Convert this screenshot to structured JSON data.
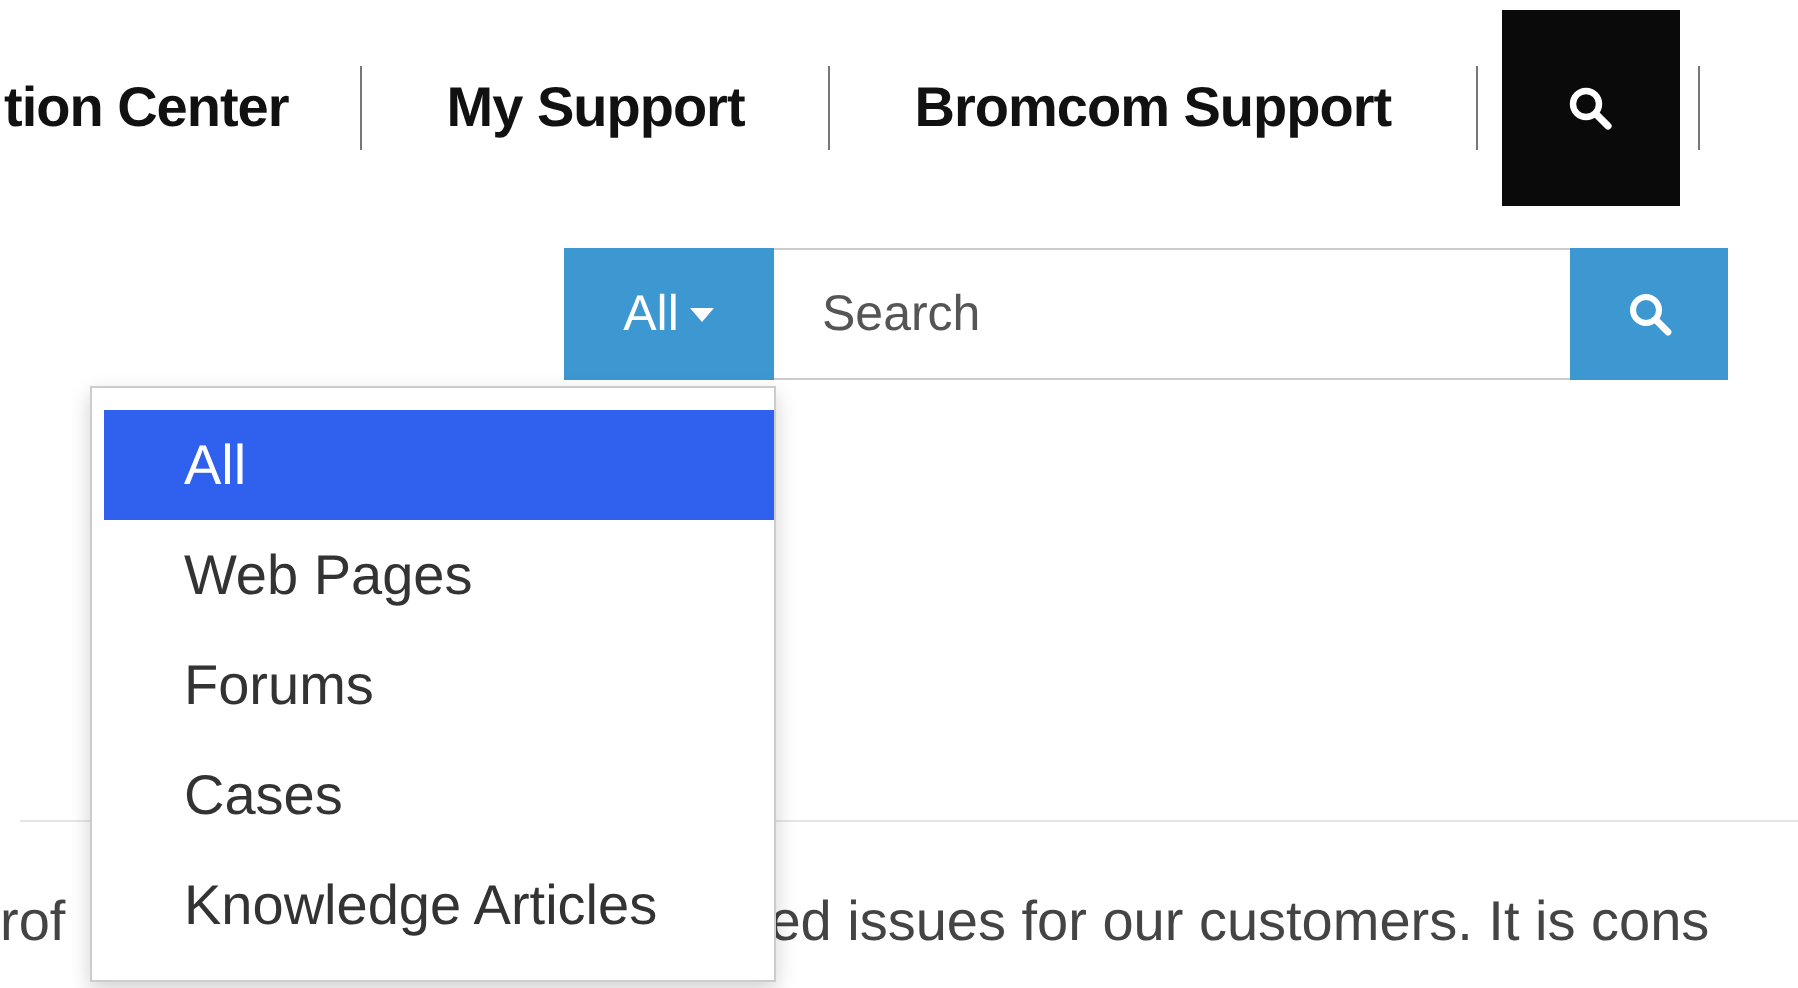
{
  "nav": {
    "items": [
      "tion Center",
      "My Support",
      "Bromcom Support"
    ]
  },
  "search": {
    "scope": "All",
    "placeholder": "Search"
  },
  "scope_menu": [
    {
      "label": "All",
      "selected": true
    },
    {
      "label": "Web Pages",
      "selected": false
    },
    {
      "label": "Forums",
      "selected": false
    },
    {
      "label": "Cases",
      "selected": false
    },
    {
      "label": "Knowledge Articles",
      "selected": false
    }
  ],
  "body_text": {
    "left": "rof",
    "right": "ed issues for our customers. It is cons"
  }
}
